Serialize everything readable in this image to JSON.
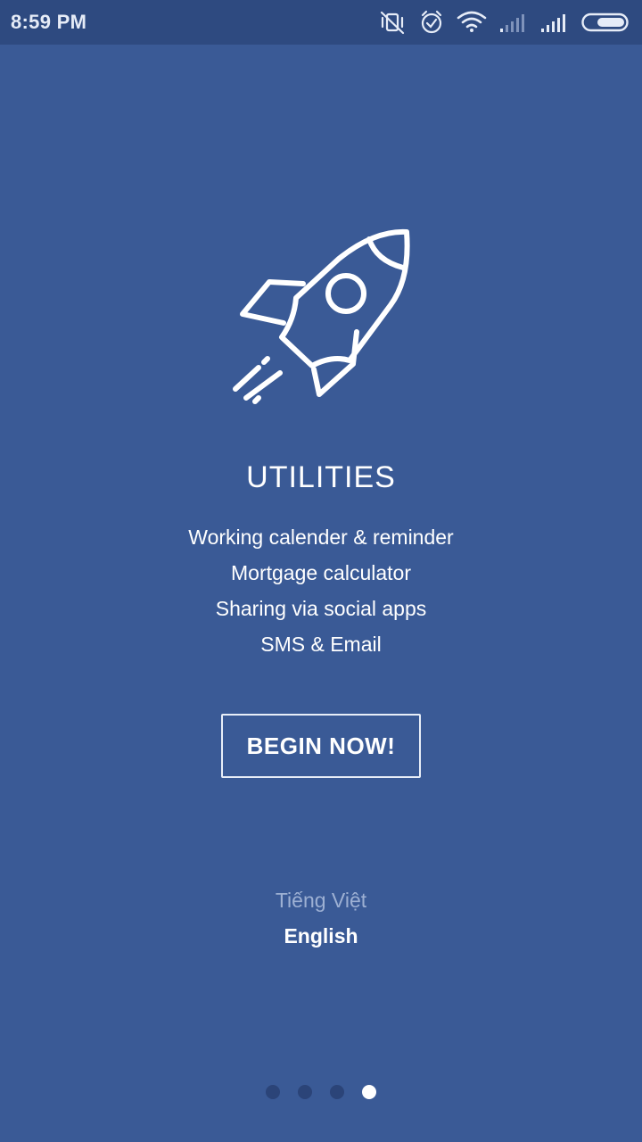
{
  "status_bar": {
    "time": "8:59 PM",
    "icons": [
      "vibrate-off-icon",
      "alarm-icon",
      "wifi-icon",
      "signal-weak-icon",
      "signal-strong-icon",
      "battery-icon"
    ]
  },
  "hero": {
    "icon": "rocket-icon",
    "title": "UTILITIES",
    "features": [
      "Working calender & reminder",
      "Mortgage calculator",
      "Sharing via social apps",
      "SMS & Email"
    ]
  },
  "cta": {
    "label": "BEGIN NOW!"
  },
  "languages": {
    "vietnamese": "Tiếng Việt",
    "english": "English",
    "selected": "English"
  },
  "pager": {
    "total": 4,
    "active_index": 3
  },
  "colors": {
    "background": "#3a5a96",
    "status_bar": "#2e4a80",
    "dot_inactive": "#2b4478",
    "dot_active": "#ffffff",
    "muted_text": "#9db0d3"
  }
}
